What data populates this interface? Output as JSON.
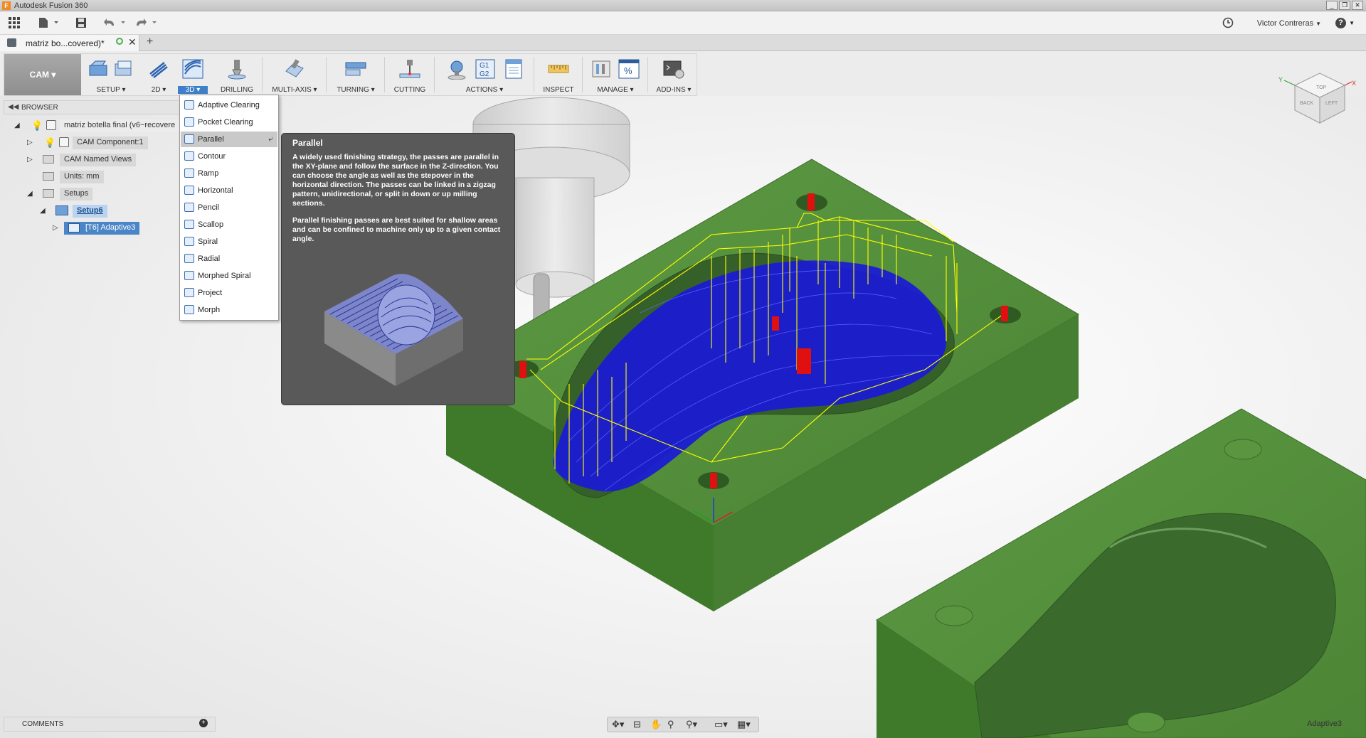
{
  "window": {
    "title": "Autodesk Fusion 360",
    "app_icon_letter": "F",
    "controls": [
      "_",
      "❐",
      "✕"
    ]
  },
  "quick_access": {
    "user_name": "Victor Contreras",
    "help_symbol": "?"
  },
  "document_tab": {
    "name": "matriz bo...covered)*",
    "close_symbol": "✕",
    "new_tab_symbol": "+"
  },
  "toolbar": {
    "workspace": "CAM ▾",
    "groups": [
      {
        "label": "SETUP ▾"
      },
      {
        "label": "2D ▾"
      },
      {
        "label": "3D ▾",
        "active": true
      },
      {
        "label": "DRILLING"
      },
      {
        "label": "MULTI-AXIS ▾"
      },
      {
        "label": "TURNING ▾"
      },
      {
        "label": "CUTTING"
      },
      {
        "label": "ACTIONS ▾"
      },
      {
        "label": "INSPECT"
      },
      {
        "label": "MANAGE ▾"
      },
      {
        "label": "ADD-INS ▾"
      }
    ],
    "actions_g_code": [
      "G1",
      "G2"
    ]
  },
  "browser": {
    "header": "BROWSER",
    "items": [
      {
        "label": "matriz botella final (v6~recovere"
      },
      {
        "label": "CAM Component:1"
      },
      {
        "label": "CAM Named Views"
      },
      {
        "label": "Units: mm"
      },
      {
        "label": "Setups"
      },
      {
        "label": "Setup6"
      },
      {
        "label": "[T6] Adaptive3"
      }
    ]
  },
  "menu_3d": {
    "items": [
      {
        "label": "Adaptive Clearing"
      },
      {
        "label": "Pocket Clearing"
      },
      {
        "label": "Parallel",
        "highlighted": true
      },
      {
        "label": "Contour"
      },
      {
        "label": "Ramp"
      },
      {
        "label": "Horizontal"
      },
      {
        "label": "Pencil"
      },
      {
        "label": "Scallop"
      },
      {
        "label": "Spiral"
      },
      {
        "label": "Radial"
      },
      {
        "label": "Morphed Spiral"
      },
      {
        "label": "Project"
      },
      {
        "label": "Morph"
      }
    ]
  },
  "tooltip": {
    "title": "Parallel",
    "paragraph1": "A widely used finishing strategy, the passes are parallel in the XY-plane and follow the surface in the Z-direction. You can choose the angle as well as the stepover in the horizontal direction. The passes can be linked in a zigzag pattern, unidirectional, or split in down or up milling sections.",
    "paragraph2": "Parallel finishing passes are best suited for shallow areas and can be confined to machine only up to a given contact angle."
  },
  "comments": {
    "label": "COMMENTS",
    "add_symbol": "+"
  },
  "viewport": {
    "active_operation": "Adaptive3",
    "view_cube_faces": [
      "TOP",
      "BACK",
      "LEFT"
    ],
    "view_cube_axes": [
      "Y",
      "X"
    ],
    "model_color": "#4f8a3a",
    "toolpath_colors": [
      "#0000ff",
      "#ffff00",
      "#ff0000"
    ]
  }
}
